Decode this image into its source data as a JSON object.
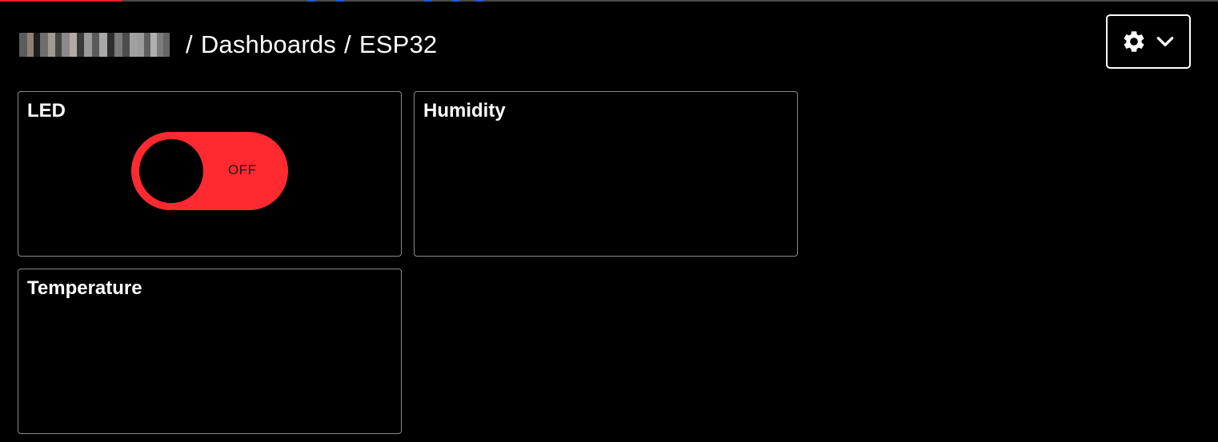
{
  "breadcrumb": {
    "user": "",
    "separator": "/",
    "section": "Dashboards",
    "dashboard": "ESP32"
  },
  "settings": {
    "icon": "gear-icon",
    "dropdown_icon": "chevron-down-icon"
  },
  "blocks": [
    {
      "title": "LED",
      "type": "toggle",
      "toggle": {
        "state_label": "OFF",
        "on": false,
        "color": "#ff2a2f"
      }
    },
    {
      "title": "Humidity",
      "type": "gauge"
    },
    {
      "title": "Temperature",
      "type": "gauge"
    }
  ],
  "colors": {
    "background": "#000000",
    "accent": "#ff2a2f",
    "card_border": "#8a8a8a"
  }
}
